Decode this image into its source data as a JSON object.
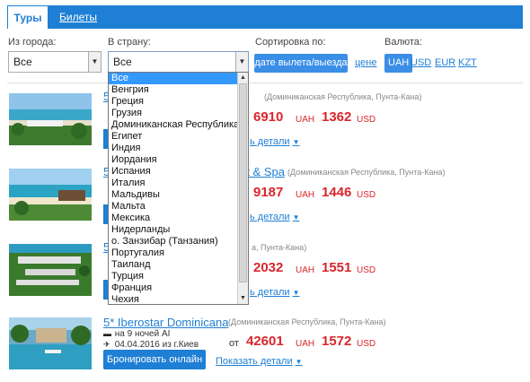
{
  "tabs": {
    "tours": "Туры",
    "tickets": "Билеты"
  },
  "filters": {
    "from_city_label": "Из города:",
    "from_city_value": "Все",
    "to_country_label": "В страну:",
    "to_country_value": "Все",
    "sort_label": "Сортировка по:",
    "sort_active": "дате вылета/выезда ↑",
    "sort_other": "цене",
    "currency_label": "Валюта:",
    "currencies": [
      "UAH",
      "USD",
      "EUR",
      "KZT"
    ],
    "currency_active": "UAH"
  },
  "country_list": [
    "Все",
    "Венгрия",
    "Греция",
    "Грузия",
    "Доминиканская Республика",
    "Египет",
    "Индия",
    "Иордания",
    "Испания",
    "Италия",
    "Мальдивы",
    "Мальта",
    "Мексика",
    "Нидерланды",
    "о. Занзибар (Танзания)",
    "Португалия",
    "Таиланд",
    "Турция",
    "Франция",
    "Чехия"
  ],
  "tours": [
    {
      "title_visible": "5",
      "title_tail": "а",
      "location": "(Доминиканская Республика, Пунта-Кана)",
      "price_uah": "6910",
      "price_usd": "1362",
      "details": "ь детали"
    },
    {
      "title_visible": "5",
      "title_tail": "rt & Spa",
      "location": "(Доминиканская Республика, Пунта-Кана)",
      "price_uah": "9187",
      "price_usd": "1446",
      "details": "ь детали"
    },
    {
      "title_visible": "5",
      "title_tail": "",
      "location": "а, Пунта-Кана)",
      "price_uah": "2032",
      "price_usd": "1551",
      "details": "ь детали"
    },
    {
      "title": "5* Iberostar Dominicana",
      "location": "(Доминиканская Республика, Пунта-Кана)",
      "nights": "на 9 ночей AI",
      "departure": "04.04.2016 из г.Киев",
      "price_from": "от",
      "price_uah": "42601",
      "price_usd": "1572",
      "book": "Бронировать онлайн",
      "details": "Показать детали"
    }
  ],
  "units": {
    "uah": "UAH",
    "usd": "USD"
  },
  "colors": {
    "accent": "#1e7fd4",
    "price": "#d9262b"
  }
}
